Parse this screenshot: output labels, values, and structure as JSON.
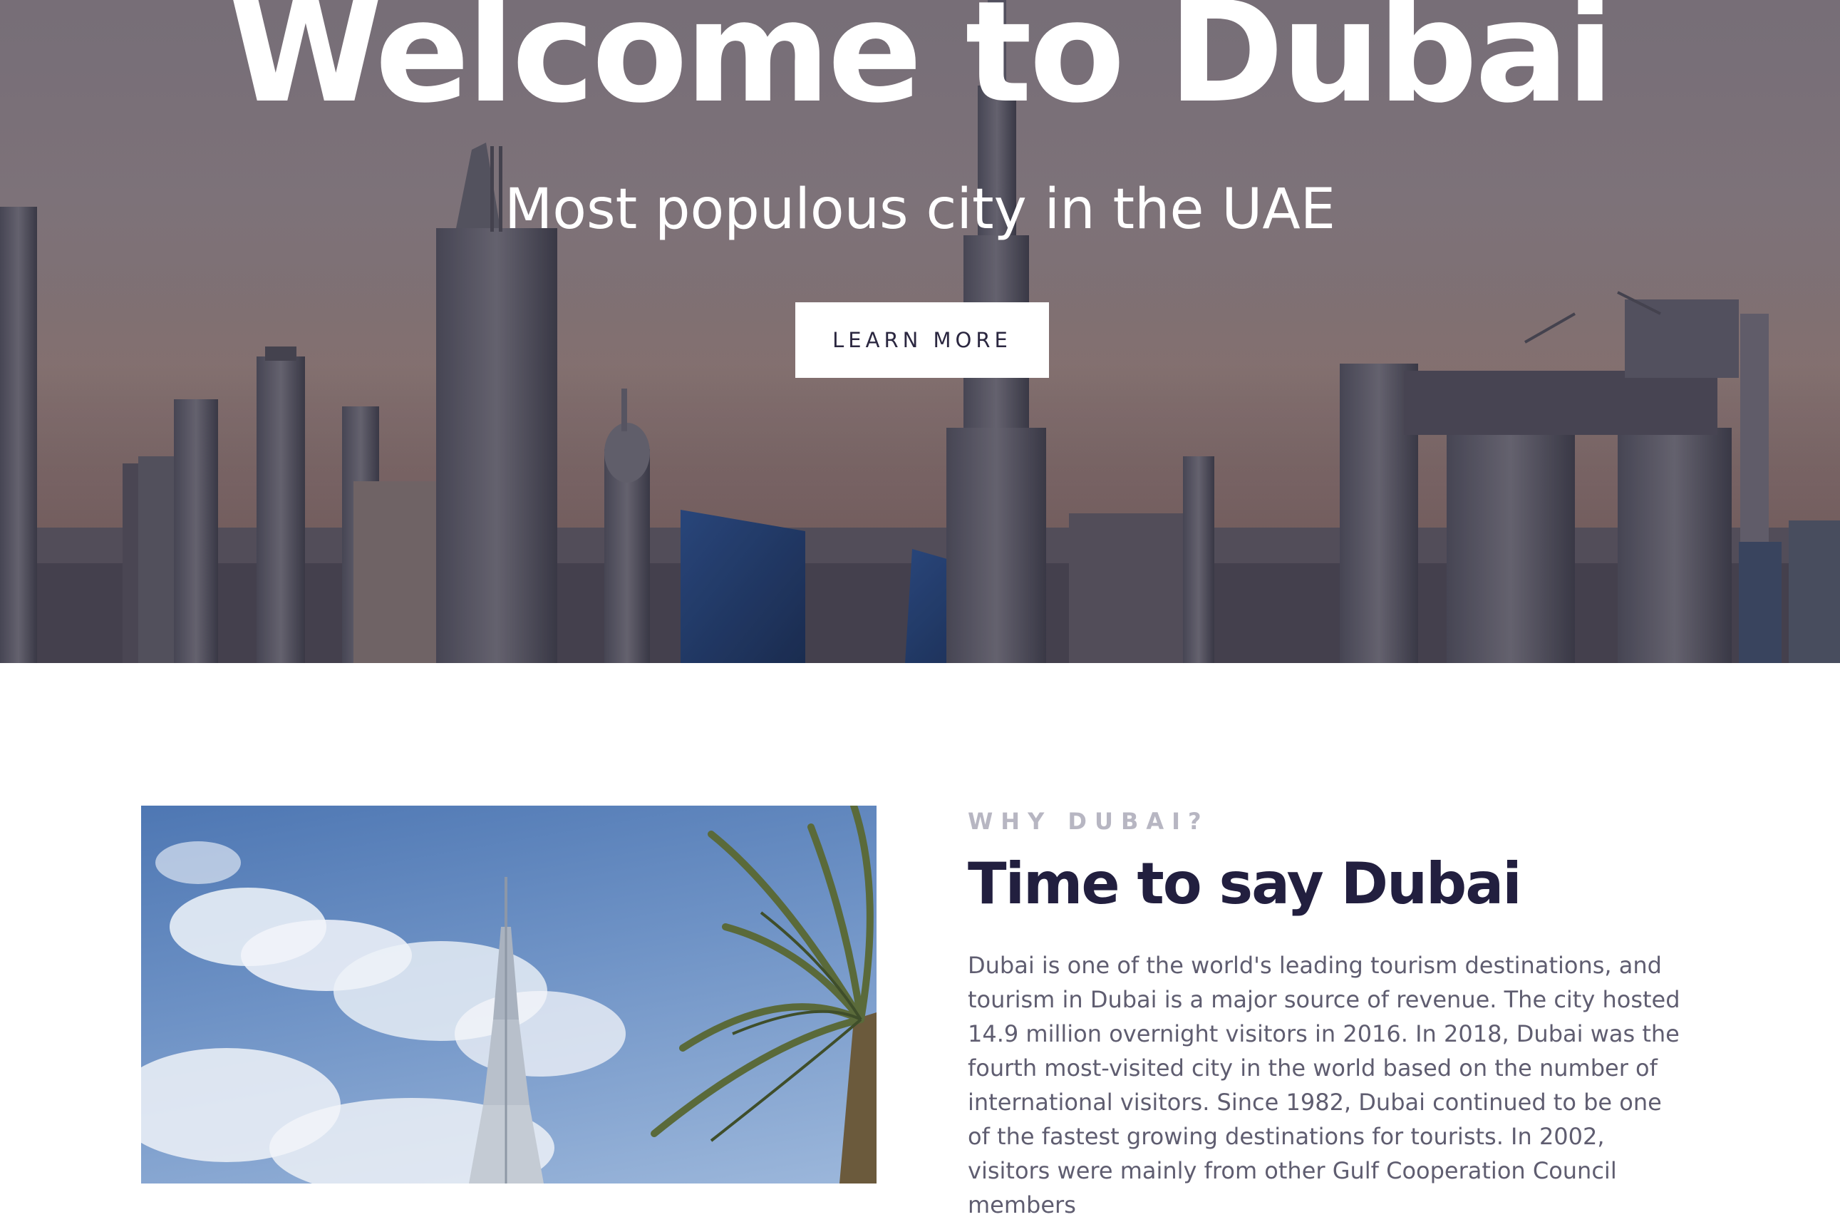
{
  "hero": {
    "title": "Welcome to Dubai",
    "subtitle": "Most populous city in the UAE",
    "cta_label": "LEARN MORE"
  },
  "about": {
    "eyebrow": "WHY DUBAI?",
    "title": "Time to say Dubai",
    "body": "Dubai is one of the world's leading tourism destinations, and tourism in Dubai is a major source of revenue. The city hosted 14.9 million overnight visitors in 2016. In 2018, Dubai was the fourth most-visited city in the world based on the number of international visitors. Since 1982, Dubai continued to be one of the fastest growing destinations for tourists. In 2002, visitors were mainly from other Gulf Cooperation Council members"
  },
  "colors": {
    "heading": "#221f3f",
    "eyebrow": "#b7b6c2",
    "body_text": "#5f5d70",
    "button_bg": "#ffffff",
    "button_text": "#2b2740"
  }
}
